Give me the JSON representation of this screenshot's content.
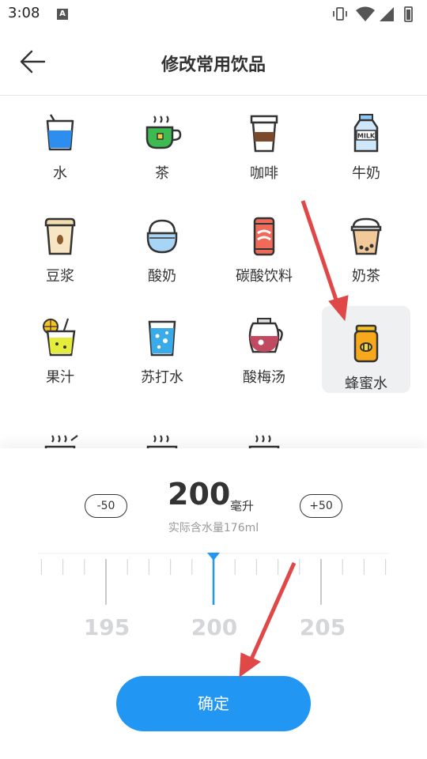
{
  "status_bar": {
    "time": "3:08",
    "notification_badge": "A"
  },
  "header": {
    "title": "修改常用饮品",
    "back_icon": "arrow-left-icon"
  },
  "drinks": [
    {
      "label": "水",
      "icon": "water-cup-icon"
    },
    {
      "label": "茶",
      "icon": "tea-cup-icon"
    },
    {
      "label": "咖啡",
      "icon": "coffee-cup-icon"
    },
    {
      "label": "牛奶",
      "icon": "milk-bottle-icon"
    },
    {
      "label": "豆浆",
      "icon": "soy-milk-cup-icon"
    },
    {
      "label": "酸奶",
      "icon": "yogurt-cup-icon"
    },
    {
      "label": "碳酸饮料",
      "icon": "soda-can-icon"
    },
    {
      "label": "奶茶",
      "icon": "bubble-tea-icon"
    },
    {
      "label": "果汁",
      "icon": "juice-glass-icon"
    },
    {
      "label": "苏打水",
      "icon": "soda-water-glass-icon"
    },
    {
      "label": "酸梅汤",
      "icon": "plum-soup-pot-icon"
    },
    {
      "label": "蜂蜜水",
      "icon": "honey-jar-icon",
      "selected": true
    }
  ],
  "amount_panel": {
    "minus_label": "-50",
    "plus_label": "+50",
    "value": "200",
    "unit": "毫升",
    "actual_water": "实际含水量176ml",
    "ruler_labels": [
      "195",
      "200",
      "205"
    ],
    "ruler_value": 200,
    "accent_color": "#2196f3",
    "confirm_label": "确定"
  },
  "annotation_color": "#e04848"
}
